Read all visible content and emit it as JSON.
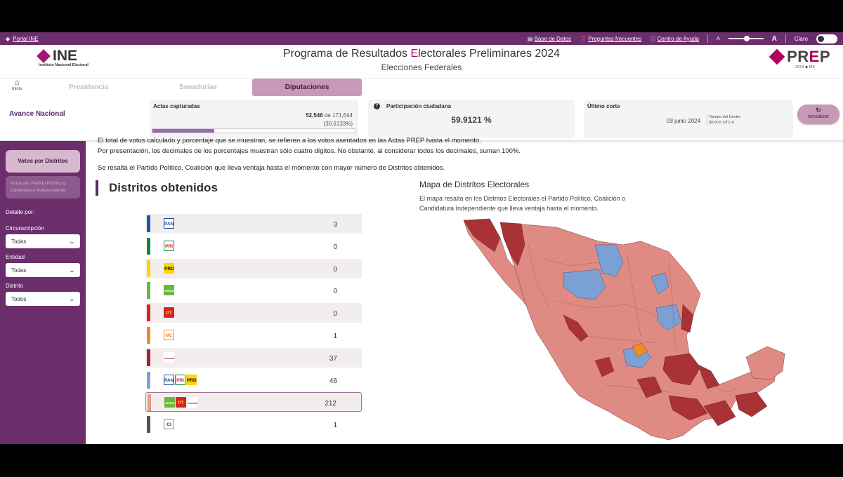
{
  "topbar": {
    "portal": "Portal INE",
    "links": [
      "Base de Datos",
      "Preguntas frecuentes",
      "Centro de Ayuda"
    ],
    "font_small": "A",
    "font_large": "A",
    "theme": "Claro"
  },
  "header": {
    "ine_logo": "INE",
    "ine_sub": "Instituto Nacional Electoral",
    "title_a": "Programa de Resultados ",
    "title_e": "E",
    "title_b": "lectorales Preliminares 2024",
    "subtitle": "Elecciones Federales",
    "prep_logo": "PREP",
    "prep_year": "2024 ◆ MX"
  },
  "tabs": {
    "home": "Inicio",
    "items": [
      "Presidencia",
      "Senadurías",
      "Diputaciones"
    ],
    "active": "Diputaciones"
  },
  "summary": {
    "avance": "Avance Nacional",
    "actas_label": "Actas capturadas",
    "actas_count": "52,546",
    "actas_of": "de",
    "actas_total": "171,644",
    "actas_pct": "(30.6133%)",
    "actas_fraction": 0.306133,
    "participacion_label": "Participación ciudadana",
    "participacion_value": "59.9121 %",
    "corte_label": "Último corte",
    "corte_date": "03 junio 2024",
    "corte_tz_1": "Tiempo del Centro",
    "corte_tz_2": "00:00 h UTC-6",
    "refresh_label": "Actualizar"
  },
  "sidebar": {
    "btn_distritos": "Votos por Distritos",
    "btn_partido": "Votos por Partido Político y Candidatura Independiente",
    "detalle": "Detalle por:",
    "circ_label": "Circunscripción",
    "circ_value": "Todas",
    "entidad_label": "Entidad",
    "entidad_value": "Todas",
    "distrito_label": "Distrito",
    "distrito_value": "Todos"
  },
  "main": {
    "note1": "El total de votos calculado y porcentaje que se muestran, se refieren a los votos asentados en las Actas PREP hasta el momento.",
    "note2": "Por presentación, los decimales de los porcentajes muestran sólo cuatro dígitos. No obstante, al considerar todos los decimales, suman 100%.",
    "note3": "Se resalta el Partido Político, Coalición que lleva ventaja hasta el momento con mayor número de Distritos obtenidos.",
    "section_title": "Distritos obtenidos",
    "map_title": "Mapa de Distritos Electorales",
    "map_desc": "El mapa resalta en los Distritos Electorales el Partido Político, Coalición o Candidatura Independiente que lleva ventaja hasta el momento."
  },
  "parties": [
    {
      "logos": [
        {
          "t": "PAN",
          "bg": "#ffffff",
          "fg": "#1a4f9c",
          "border": "#1a4f9c"
        }
      ],
      "value": "3",
      "color": "#1f56a8"
    },
    {
      "logos": [
        {
          "t": "PRI",
          "bg": "#ffffff",
          "fg": "#d8222a",
          "border": "#0a8a3a"
        }
      ],
      "value": "0",
      "color": "#0a8a3a"
    },
    {
      "logos": [
        {
          "t": "PRD",
          "bg": "#ffd400",
          "fg": "#111111",
          "border": "#ffd400"
        }
      ],
      "value": "0",
      "color": "#ffd400"
    },
    {
      "logos": [
        {
          "t": "VERDE",
          "bg": "#6ab83a",
          "fg": "#ffffff",
          "border": "#6ab83a"
        }
      ],
      "value": "0",
      "color": "#6ab83a"
    },
    {
      "logos": [
        {
          "t": "PT",
          "bg": "#d8222a",
          "fg": "#ffd400",
          "border": "#d8222a"
        }
      ],
      "value": "0",
      "color": "#d8222a"
    },
    {
      "logos": [
        {
          "t": "MC",
          "bg": "#ffffff",
          "fg": "#f08a24",
          "border": "#f08a24"
        }
      ],
      "value": "1",
      "color": "#f08a24"
    },
    {
      "logos": [
        {
          "t": "morena",
          "bg": "#ffffff",
          "fg": "#a6223a",
          "border": "#ffffff"
        }
      ],
      "value": "37",
      "color": "#a6223a"
    },
    {
      "logos": [
        {
          "t": "PAN",
          "bg": "#ffffff",
          "fg": "#1a4f9c",
          "border": "#1a4f9c"
        },
        {
          "t": "PRI",
          "bg": "#ffffff",
          "fg": "#d8222a",
          "border": "#0a8a3a"
        },
        {
          "t": "PRD",
          "bg": "#ffd400",
          "fg": "#111111",
          "border": "#ffd400"
        }
      ],
      "value": "46",
      "color": "#7ea2d8"
    },
    {
      "logos": [
        {
          "t": "VERDE",
          "bg": "#6ab83a",
          "fg": "#ffffff",
          "border": "#6ab83a"
        },
        {
          "t": "PT",
          "bg": "#d8222a",
          "fg": "#ffd400",
          "border": "#d8222a"
        },
        {
          "t": "morena",
          "bg": "#ffffff",
          "fg": "#a6223a",
          "border": "#ffffff"
        }
      ],
      "value": "212",
      "color": "#e8998f",
      "highlight": true
    },
    {
      "logos": [
        {
          "t": "CI",
          "bg": "#ffffff",
          "fg": "#333333",
          "border": "#888888"
        }
      ],
      "value": "1",
      "color": "#555555"
    }
  ],
  "map_colors": {
    "morena": "#a83236",
    "coalition": "#e08a84",
    "opposition": "#7aa0d4",
    "mc": "#f08a24"
  }
}
